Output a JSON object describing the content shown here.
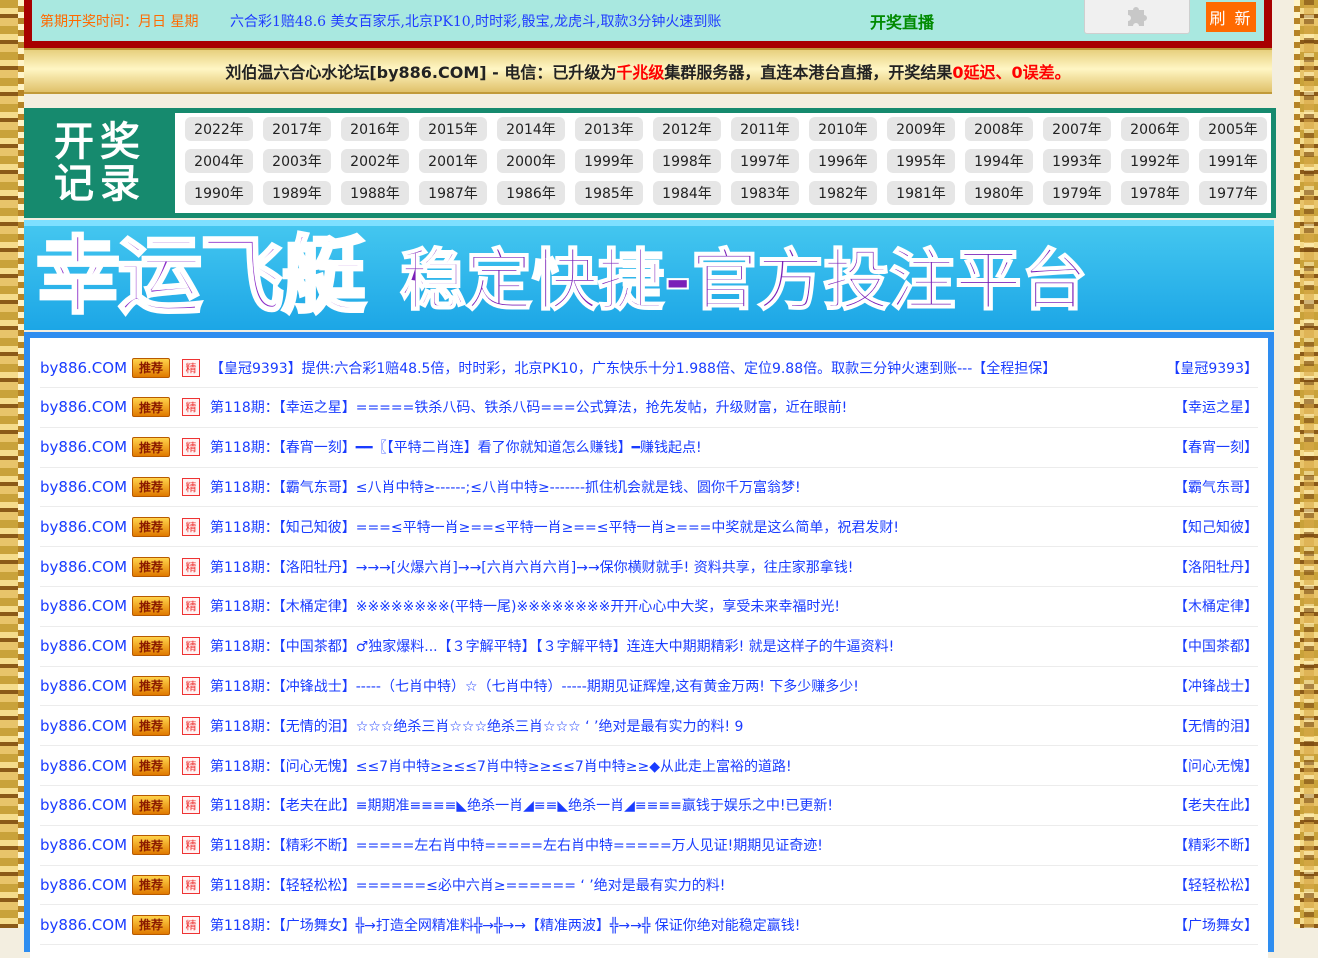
{
  "header": {
    "draw_time": "第期开奖时间：月日 星期",
    "promo": "六合彩1赔48.6  美女百家乐,北京PK10,时时彩,骰宝,龙虎斗,取款3分钟火速到账",
    "live": "开奖直播",
    "plugin_icon": "puzzle-icon",
    "refresh": "刷 新"
  },
  "banner": {
    "part1": "刘伯温六合心水论坛[by886.COM] - 电信：已升级为",
    "part2": "千兆级",
    "part3": "集群服务器，直连本港台直播，开奖结果",
    "part4": "0延迟、0误差。"
  },
  "records": {
    "label_line1": "开奖",
    "label_line2": "记录",
    "years": [
      "2022年",
      "2017年",
      "2016年",
      "2015年",
      "2014年",
      "2013年",
      "2012年",
      "2011年",
      "2010年",
      "2009年",
      "2008年",
      "2007年",
      "2006年",
      "2005年",
      "2004年",
      "2003年",
      "2002年",
      "2001年",
      "2000年",
      "1999年",
      "1998年",
      "1997年",
      "1996年",
      "1995年",
      "1994年",
      "1993年",
      "1992年",
      "1991年",
      "1990年",
      "1989年",
      "1988年",
      "1987年",
      "1986年",
      "1985年",
      "1984年",
      "1983年",
      "1982年",
      "1981年",
      "1980年",
      "1979年",
      "1978年",
      "1977年"
    ]
  },
  "ad": {
    "title": "幸运飞艇",
    "subtitle": "稳定快捷-官方投注平台"
  },
  "list": {
    "site": "by886.COM",
    "rec_tag": "推荐",
    "jing_tag": "精",
    "rows": [
      {
        "text": "【皇冠9393】提供:六合彩1赔48.5倍，时时彩，北京PK10，广东快乐十分1.988倍、定位9.88倍。取款三分钟火速到账---【全程担保】",
        "right": "【皇冠9393】"
      },
      {
        "text": "第118期：【幸运之星】=====铁杀八码、铁杀八码===公式算法，抢先发帖，升级财富，近在眼前!",
        "right": "【幸运之星】"
      },
      {
        "text": "第118期：【春宵一刻】━━〖【平特二肖连】看了你就知道怎么赚钱】━赚钱起点!",
        "right": "【春宵一刻】"
      },
      {
        "text": "第118期：【霸气东哥】≤八肖中特≥------;≤八肖中特≥-------抓住机会就是钱、圆你千万富翁梦!",
        "right": "【霸气东哥】"
      },
      {
        "text": "第118期：【知己知彼】===≤平特一肖≥==≤平特一肖≥==≤平特一肖≥===中奖就是这么简单，祝君发财!",
        "right": "【知己知彼】"
      },
      {
        "text": "第118期：【洛阳牡丹】→→→[火爆六肖]→→[六肖六肖六肖]→→保你横财就手! 资料共享，往庄家那拿钱!",
        "right": "【洛阳牡丹】"
      },
      {
        "text": "第118期：【木桶定律】※※※※※※※※(平特一尾)※※※※※※※※开开心心中大奖，享受未来幸福时光!",
        "right": "【木桶定律】"
      },
      {
        "text": "第118期：【中国茶都】♂独家爆料...【３字解平特】【３字解平特】连连大中期期精彩! 就是这样子的牛逼资料!",
        "right": "【中国茶都】"
      },
      {
        "text": "第118期：【冲锋战士】-----（七肖中特）☆（七肖中特）-----期期见证辉煌,这有黄金万两! 下多少赚多少!",
        "right": "【冲锋战士】"
      },
      {
        "text": "第118期：【无情的泪】☆☆☆绝杀三肖☆☆☆绝杀三肖☆☆☆ ‘ ’绝对是最有实力的料! 9",
        "right": "【无情的泪】"
      },
      {
        "text": "第118期：【问心无愧】≤≤7肖中特≥≥≤≤7肖中特≥≥≤≤7肖中特≥≥◆从此走上富裕的道路!",
        "right": "【问心无愧】"
      },
      {
        "text": "第118期：【老夫在此】≡期期准≡≡≡≡◣绝杀一肖◢≡≡◣绝杀一肖◢≡≡≡≡赢钱于娱乐之中!已更新!",
        "right": "【老夫在此】"
      },
      {
        "text": "第118期：【精彩不断】=====左右肖中特=====左右肖中特=====万人见证!期期见证奇迹!",
        "right": "【精彩不断】"
      },
      {
        "text": "第118期：【轻轻松松】======≤必中六肖≥====== ‘ ’绝对是最有实力的料!",
        "right": "【轻轻松松】"
      },
      {
        "text": "第118期：【广场舞女】╬→打造全网精准料╬→╬→→【精准两波】╬→→╬ 保证你绝对能稳定赢钱!",
        "right": "【广场舞女】"
      }
    ]
  }
}
